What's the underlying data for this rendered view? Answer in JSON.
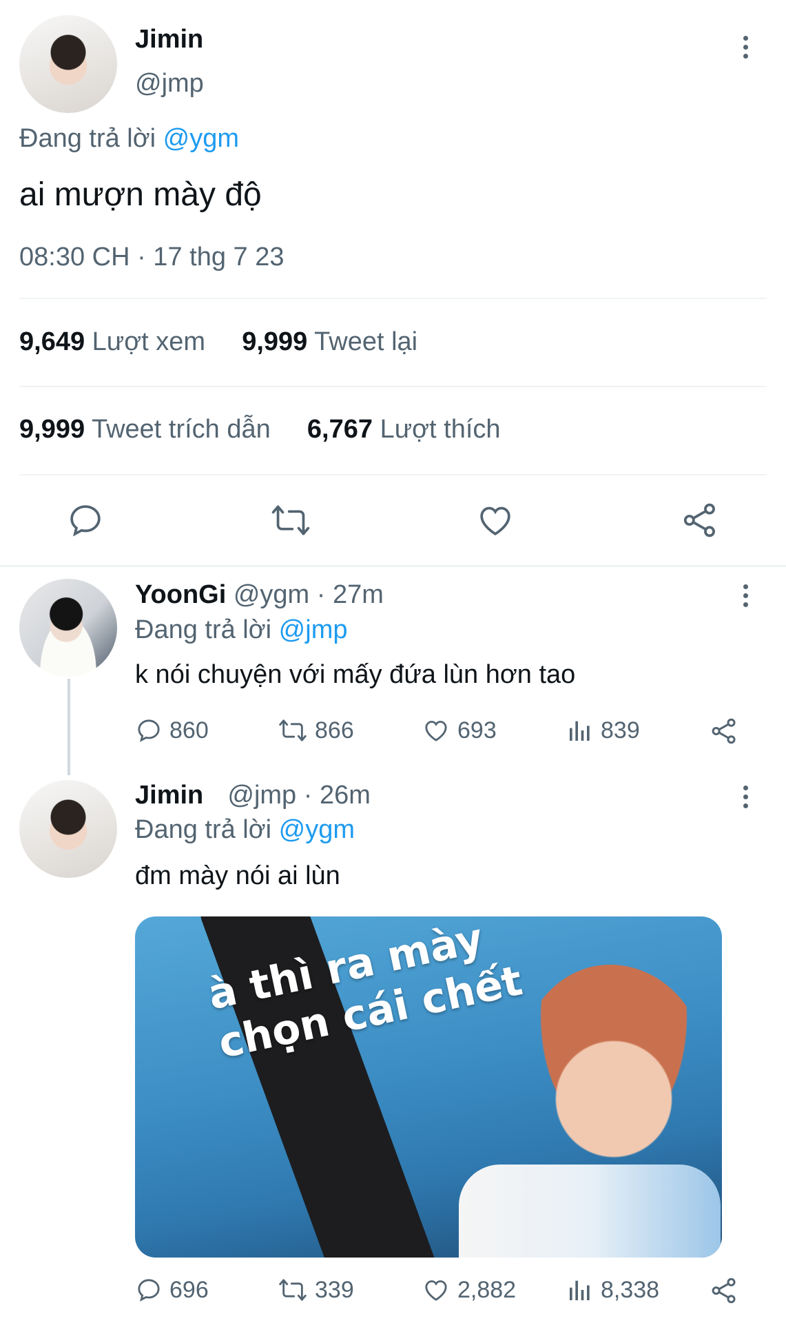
{
  "main_tweet": {
    "display_name": "Jimin",
    "handle": "@jmp",
    "replying_prefix": "Đang trả lời",
    "replying_to": "@ygm",
    "text": "ai mượn mày độ",
    "timestamp": "08:30 CH · 17 thg 7 23",
    "stats": {
      "views_count": "9,649",
      "views_label": "Lượt xem",
      "retweets_count": "9,999",
      "retweets_label": "Tweet lại",
      "quotes_count": "9,999",
      "quotes_label": "Tweet trích dẫn",
      "likes_count": "6,767",
      "likes_label": "Lượt thích"
    },
    "actions": [
      "reply-icon",
      "retweet-icon",
      "like-icon",
      "share-icon"
    ]
  },
  "replies": [
    {
      "display_name": "YoonGi",
      "handle": "@ygm",
      "time": "· 27m",
      "replying_prefix": "Đang trả lời",
      "replying_to": "@jmp",
      "text": "k nói chuyện với mấy đứa lùn hơn tao",
      "reply_count": "860",
      "retweet_count": "866",
      "like_count": "693",
      "view_count": "839"
    },
    {
      "display_name": "Jimin",
      "handle": "@jmp",
      "time": "· 26m",
      "replying_prefix": "Đang trả lời",
      "replying_to": "@ygm",
      "text": "đm mày nói ai lùn",
      "image_caption": "à thì ra mày chọn cái chết",
      "reply_count": "696",
      "retweet_count": "339",
      "like_count": "2,882",
      "view_count": "8,338"
    }
  ],
  "colors": {
    "accent": "#1d9bf0",
    "secondary_text": "#536471",
    "divider": "#eff3f4"
  }
}
